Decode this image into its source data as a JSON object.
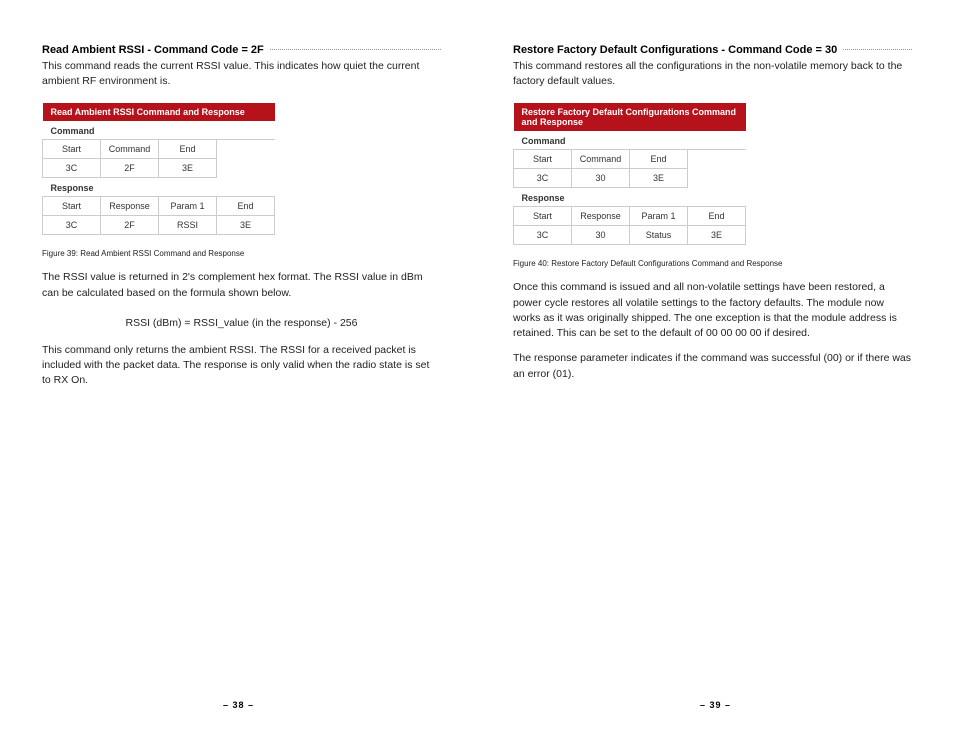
{
  "left": {
    "title": "Read Ambient RSSI - Command Code = 2F",
    "intro": "This command reads the current RSSI value. This indicates how quiet the current ambient RF environment is.",
    "table": {
      "header": "Read Ambient RSSI Command and Response",
      "command_label": "Command",
      "command_cols": [
        "Start",
        "Command",
        "End"
      ],
      "command_vals": [
        "3C",
        "2F",
        "3E"
      ],
      "response_label": "Response",
      "response_cols": [
        "Start",
        "Response",
        "Param 1",
        "End"
      ],
      "response_vals": [
        "3C",
        "2F",
        "RSSI",
        "3E"
      ]
    },
    "caption": "Figure 39: Read Ambient RSSI Command and Response",
    "para1": "The RSSI value is returned in 2's complement hex format. The RSSI value in dBm can be calculated based on the formula shown below.",
    "formula": "RSSI (dBm) = RSSI_value (in the response) - 256",
    "para2": "This command only returns the ambient RSSI. The RSSI for a received packet is included with the packet data. The response is only valid when the radio state is set to RX On.",
    "page_num": "– 38 –"
  },
  "right": {
    "title": "Restore Factory Default Configurations - Command Code = 30",
    "intro": "This command restores all the configurations in the non-volatile memory back to the factory default values.",
    "table": {
      "header": "Restore Factory Default Configurations Command and Response",
      "command_label": "Command",
      "command_cols": [
        "Start",
        "Command",
        "End"
      ],
      "command_vals": [
        "3C",
        "30",
        "3E"
      ],
      "response_label": "Response",
      "response_cols": [
        "Start",
        "Response",
        "Param 1",
        "End"
      ],
      "response_vals": [
        "3C",
        "30",
        "Status",
        "3E"
      ]
    },
    "caption": "Figure 40: Restore Factory Default Configurations Command and Response",
    "para1": "Once this command is issued and all non-volatile settings have been restored, a power cycle restores all volatile settings to the factory defaults. The module now works as it was originally shipped. The one exception is that the module address is retained. This can be set to the default of 00 00 00 00 if desired.",
    "para2": "The response parameter indicates if the command was successful (00) or if there was an error (01).",
    "page_num": "– 39 –"
  }
}
